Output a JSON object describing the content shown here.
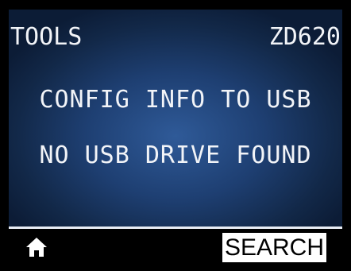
{
  "header": {
    "title": "TOOLS",
    "model": "ZD620"
  },
  "message": {
    "line1": "CONFIG INFO TO USB",
    "line2": "NO USB DRIVE FOUND"
  },
  "footer": {
    "home_icon": "home-icon",
    "search_label": "SEARCH"
  },
  "colors": {
    "screen_bg": "#1e3f72",
    "text": "#f2f4f8",
    "softkey_bg": "#ffffff"
  }
}
